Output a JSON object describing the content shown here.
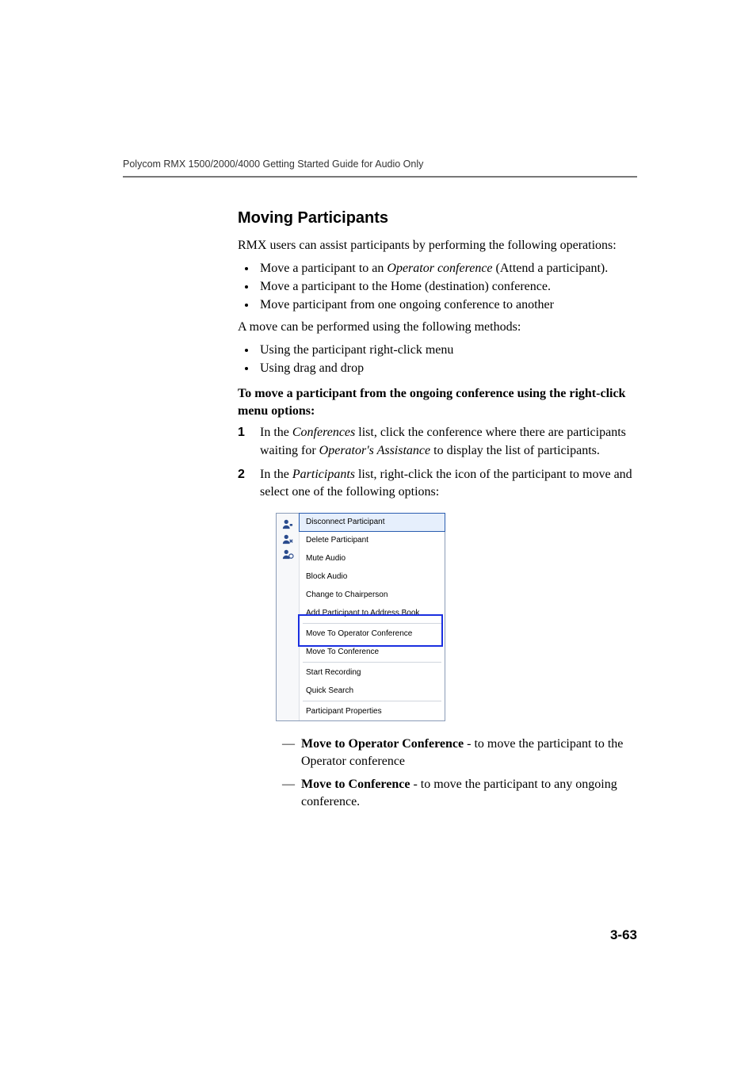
{
  "running_header": "Polycom RMX 1500/2000/4000 Getting Started Guide for Audio Only",
  "section_title": "Moving Participants",
  "intro": "RMX users can assist participants by performing the following operations:",
  "ops_bullets": [
    {
      "pre": "Move a participant to an ",
      "italic": "Operator conference",
      "post": " (Attend a participant)."
    },
    {
      "pre": "Move a participant to the Home (destination) conference.",
      "italic": "",
      "post": ""
    },
    {
      "pre": "Move participant from one ongoing conference to another",
      "italic": "",
      "post": ""
    }
  ],
  "methods_intro": "A move can be performed using the following methods:",
  "methods_bullets": [
    "Using the participant right-click menu",
    "Using drag and drop"
  ],
  "procedure_heading": "To move a participant from the ongoing conference using the right-click menu options:",
  "steps": {
    "s1": {
      "pre": "In the ",
      "italic1": "Conferences",
      "mid": " list, click the conference where there are participants waiting for ",
      "italic2": "Operator's Assistance",
      "post": " to display the list of participants."
    },
    "s2": {
      "pre": "In the ",
      "italic1": "Participants",
      "post": " list, right-click the icon of the participant to move and select one of the following options:"
    }
  },
  "menu": {
    "items": [
      "Disconnect Participant",
      "Delete Participant",
      "Mute Audio",
      "Block Audio",
      "Change to Chairperson",
      "Add Participant to Address Book",
      "Move To Operator Conference",
      "Move To Conference",
      "Start Recording",
      "Quick Search",
      "Participant Properties"
    ]
  },
  "options": {
    "o1": {
      "bold": "Move to Operator Conference",
      "rest": " - to move the participant to the Operator conference"
    },
    "o2": {
      "bold": "Move to Conference",
      "rest": " - to move the participant to any ongoing conference."
    }
  },
  "page_number": "3-63"
}
